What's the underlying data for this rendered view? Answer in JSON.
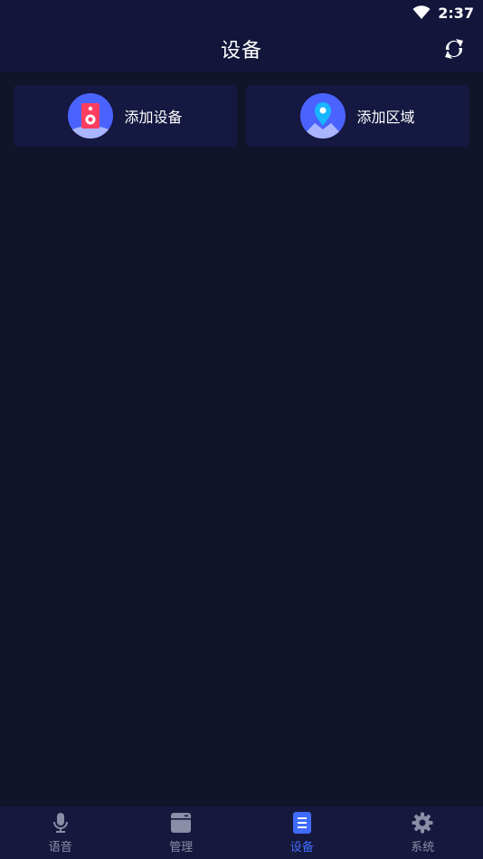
{
  "status_bar": {
    "time": "2:37"
  },
  "header": {
    "title": "设备"
  },
  "actions": [
    {
      "label": "添加设备",
      "icon": "speaker-icon"
    },
    {
      "label": "添加区域",
      "icon": "location-pin-icon"
    }
  ],
  "bottom_nav": {
    "active_index": 2,
    "items": [
      {
        "label": "语音",
        "icon": "microphone-icon"
      },
      {
        "label": "管理",
        "icon": "calendar-icon"
      },
      {
        "label": "设备",
        "icon": "list-icon"
      },
      {
        "label": "系统",
        "icon": "gear-icon"
      }
    ]
  },
  "colors": {
    "background": "#12152a",
    "header": "#13163a",
    "card": "#151840",
    "accent": "#3f6bff",
    "nav_inactive": "#8a8da6"
  }
}
